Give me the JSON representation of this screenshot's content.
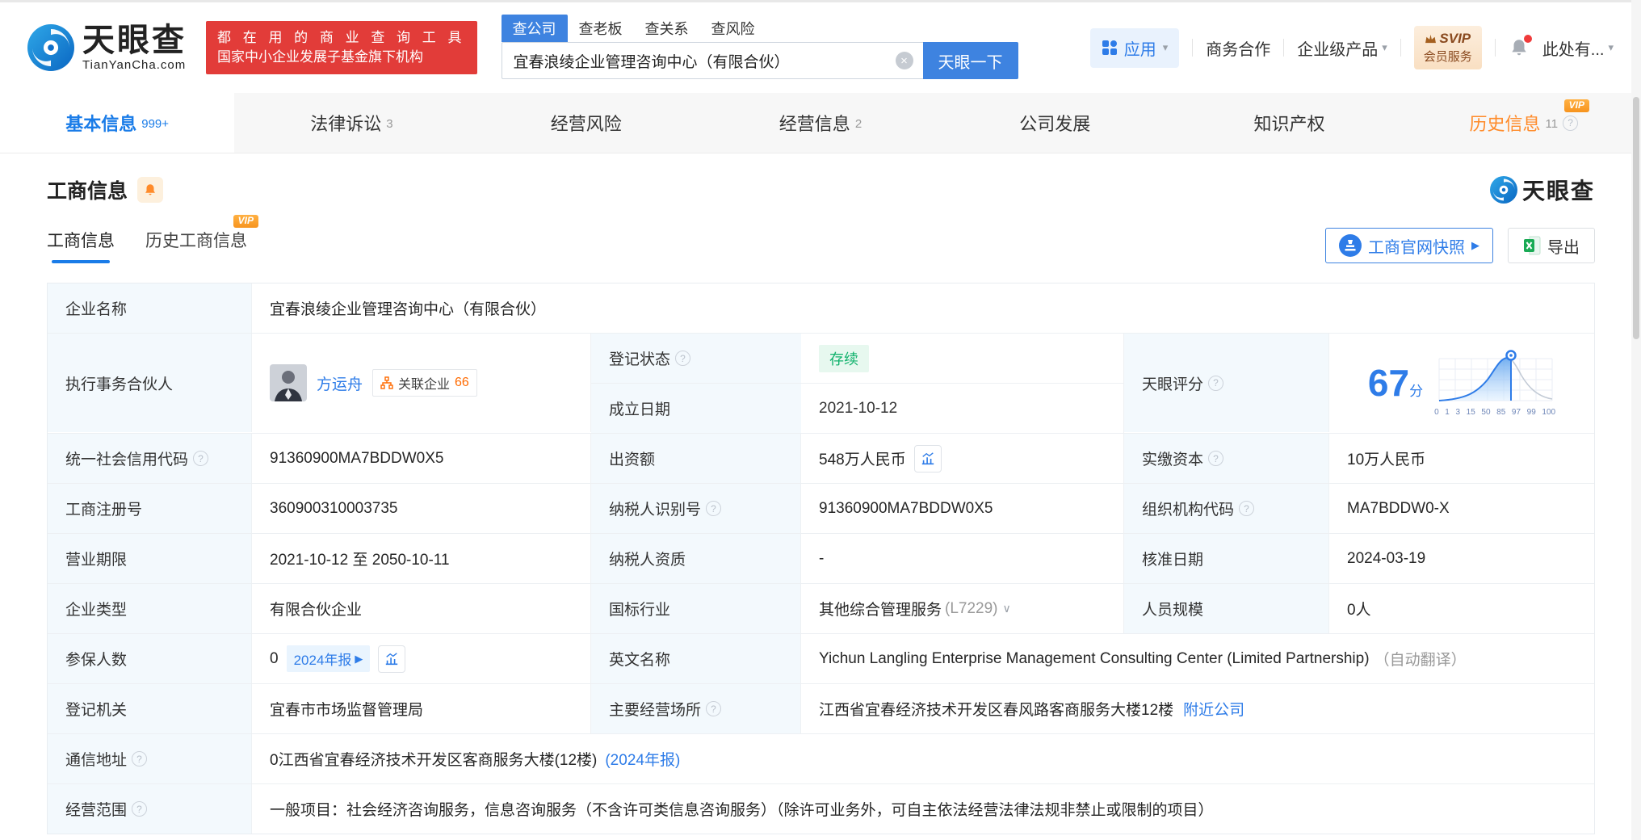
{
  "misc": {
    "vip": "VIP",
    "help": "?",
    "caret_down": "▾",
    "arrow_right": "▶",
    "chevron_down": "∨",
    "close": "×",
    "at": "至"
  },
  "colors": {
    "brand_blue": "#2e7ce8",
    "button_blue": "#3e83e0",
    "nav_active_blue": "#1a7ce8",
    "orange": "#ff8b2a",
    "status_green": "#10b26c",
    "promo_red": "#e23c39",
    "excel_green": "#1aaa55",
    "label_cell_bg": "#f3f9fd"
  },
  "header": {
    "logo": {
      "cn": "天眼查",
      "en": "TianYanCha.com"
    },
    "promo": {
      "line1": "都 在 用 的 商 业 查 询 工 具",
      "line2": "国家中小企业发展子基金旗下机构"
    },
    "search": {
      "tabs": [
        {
          "label": "查公司"
        },
        {
          "label": "查老板"
        },
        {
          "label": "查关系"
        },
        {
          "label": "查风险"
        }
      ],
      "value": "宜春浪绫企业管理咨询中心（有限合伙）",
      "button": "天眼一下"
    },
    "right": {
      "apps": "应用",
      "cooperation": "商务合作",
      "enterprise": "企业级产品",
      "svip_line1": "SVIP",
      "svip_line2": "会员服务",
      "user": "此处有..."
    }
  },
  "tabs": [
    {
      "label": "基本信息",
      "count": "999+"
    },
    {
      "label": "法律诉讼",
      "count": "3"
    },
    {
      "label": "经营风险",
      "count": ""
    },
    {
      "label": "经营信息",
      "count": "2"
    },
    {
      "label": "公司发展",
      "count": ""
    },
    {
      "label": "知识产权",
      "count": ""
    },
    {
      "label": "历史信息",
      "count": "11"
    }
  ],
  "section": {
    "title": "工商信息",
    "watermark": "天眼查",
    "subtab_active": "工商信息",
    "subtab_history": "历史工商信息",
    "snapshot_button": "工商官网快照",
    "export_button": "导出"
  },
  "table": {
    "company_name": {
      "label": "企业名称",
      "value": "宜春浪绫企业管理咨询中心（有限合伙）"
    },
    "partner": {
      "label": "执行事务合伙人",
      "name": "方运舟",
      "related_label": "关联企业",
      "related_count": "66"
    },
    "reg_status": {
      "label": "登记状态",
      "value": "存续"
    },
    "establish_date": {
      "label": "成立日期",
      "value": "2021-10-12"
    },
    "score": {
      "label": "天眼评分",
      "value": "67",
      "unit": "分",
      "axis": [
        "0",
        "1",
        "3",
        "15",
        "50",
        "85",
        "97",
        "99",
        "100"
      ]
    },
    "credit_code": {
      "label": "统一社会信用代码",
      "value": "91360900MA7BDDW0X5"
    },
    "capital": {
      "label": "出资额",
      "value": "548万人民币"
    },
    "paid_capital": {
      "label": "实缴资本",
      "value": "10万人民币"
    },
    "reg_number": {
      "label": "工商注册号",
      "value": "360900310003735"
    },
    "taxpayer_id": {
      "label": "纳税人识别号",
      "value": "91360900MA7BDDW0X5"
    },
    "org_code": {
      "label": "组织机构代码",
      "value": "MA7BDDW0-X"
    },
    "business_term": {
      "label": "营业期限",
      "value": "2021-10-12 至 2050-10-11"
    },
    "taxpayer_qualification": {
      "label": "纳税人资质",
      "value": "-"
    },
    "approval_date": {
      "label": "核准日期",
      "value": "2024-03-19"
    },
    "company_type": {
      "label": "企业类型",
      "value": "有限合伙企业"
    },
    "industry": {
      "label": "国标行业",
      "value": "其他综合管理服务",
      "code": "(L7229)"
    },
    "staff_size": {
      "label": "人员规模",
      "value": "0人"
    },
    "insured_count": {
      "label": "参保人数",
      "value": "0",
      "report_chip": "2024年报"
    },
    "english_name": {
      "label": "英文名称",
      "value": "Yichun Langling Enterprise Management Consulting Center (Limited Partnership)",
      "note": "（自动翻译）"
    },
    "reg_authority": {
      "label": "登记机关",
      "value": "宜春市市场监督管理局"
    },
    "business_site": {
      "label": "主要经营场所",
      "value": "江西省宜春经济技术开发区春风路客商服务大楼12楼",
      "link": "附近公司"
    },
    "mailing_address": {
      "label": "通信地址",
      "value": "0江西省宜春经济技术开发区客商服务大楼(12楼)",
      "link": "(2024年报)"
    },
    "business_scope": {
      "label": "经营范围",
      "value": "一般项目：社会经济咨询服务，信息咨询服务（不含许可类信息咨询服务）（除许可业务外，可自主依法经营法律法规非禁止或限制的项目）"
    }
  }
}
